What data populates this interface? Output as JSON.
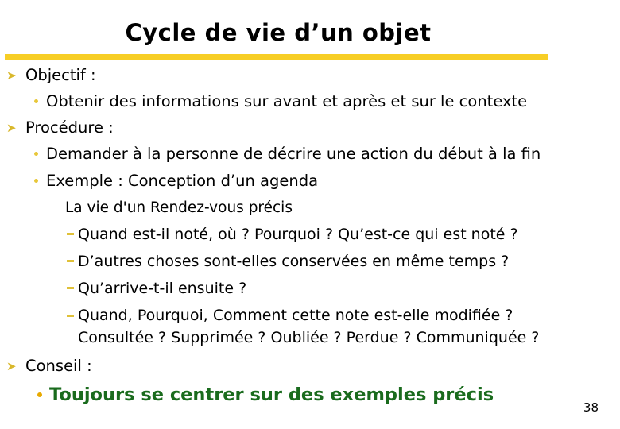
{
  "slide": {
    "title": "Cycle de vie d’un objet",
    "page_number": "38",
    "accent_color": "#F7CE26",
    "bullet_arrow_color": "#D9B82C",
    "bullet_dot_color": "#E8C73A",
    "highlight_color": "#1A6B1D",
    "arrow_glyph": "➤"
  },
  "content": {
    "objectif_heading": "Objectif :",
    "objectif_bullet_1": "Obtenir des informations sur avant et après et sur le contexte",
    "procedure_heading": "Procédure :",
    "procedure_bullet_1": "Demander à la personne de décrire une action du début à la fin",
    "procedure_bullet_2": "Exemple : Conception d’un agenda",
    "sub_heading": "La vie d'un Rendez-vous précis",
    "question_1": "Quand est-il noté, où ? Pourquoi ? Qu’est-ce qui est noté ?",
    "question_2": "D’autres choses sont-elles conservées en même temps ?",
    "question_3": "Qu’arrive-t-il ensuite ?",
    "question_4_line1": "Quand, Pourquoi, Comment cette note est-elle  modifiée ?",
    "question_4_line2": "Consultée ? Supprimée ? Oubliée ? Perdue ? Communiquée ?",
    "conseil_heading": "Conseil :",
    "conseil_bullet_1": "Toujours se centrer sur des exemples précis"
  }
}
